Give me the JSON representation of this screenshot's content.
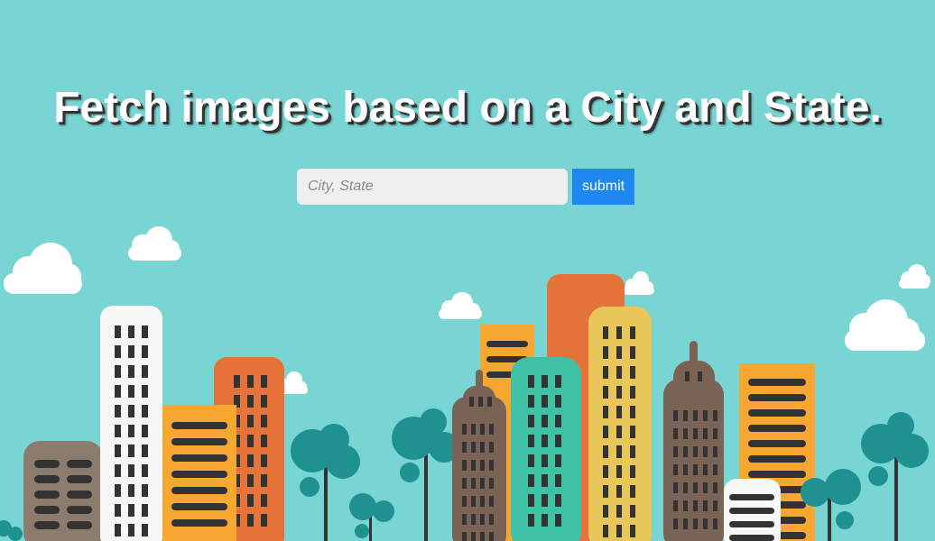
{
  "page": {
    "headline": "Fetch images based on a City and State."
  },
  "search": {
    "placeholder": "City, State",
    "value": "",
    "submit_label": "submit"
  },
  "colors": {
    "background": "#79d5d4",
    "submit_button": "#1e87f0",
    "input_background": "#efefef"
  },
  "illustration": {
    "icon": "cityscape-illustration"
  }
}
